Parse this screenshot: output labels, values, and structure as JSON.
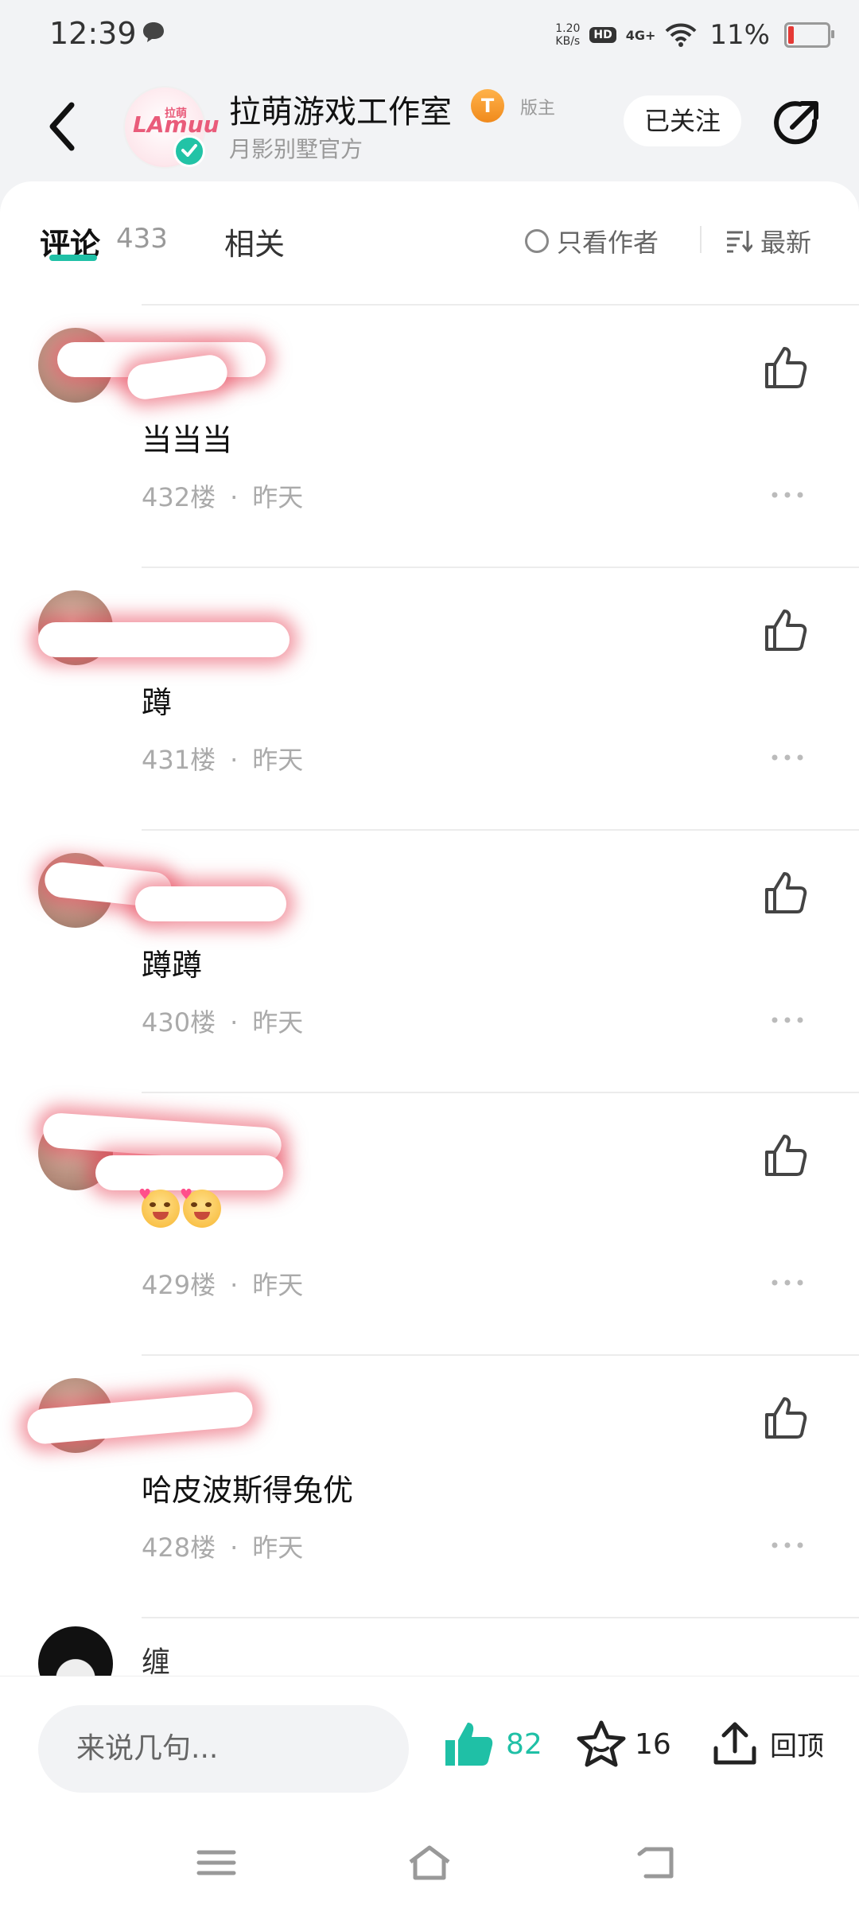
{
  "status": {
    "time": "12:39",
    "net_speed_top": "1.20",
    "net_speed_bottom": "KB/s",
    "hd": "HD",
    "signal": "4G+",
    "battery": "11%"
  },
  "header": {
    "title": "拉萌游戏工作室",
    "level_badge": "T",
    "role": "版主",
    "subtitle": "月影别墅官方",
    "follow_label": "已关注",
    "avatar_logo": "LAmuu",
    "avatar_logo_small": "拉萌"
  },
  "tabs": {
    "comment_label": "评论",
    "comment_count": "433",
    "related_label": "相关",
    "author_only": "只看作者",
    "sort": "最新"
  },
  "comments": [
    {
      "text": "当当当",
      "floor": "432楼",
      "time": "昨天"
    },
    {
      "text": "蹲",
      "floor": "431楼",
      "time": "昨天"
    },
    {
      "text": "蹲蹲",
      "floor": "430楼",
      "time": "昨天"
    },
    {
      "text": "",
      "floor": "429楼",
      "time": "昨天"
    },
    {
      "text": "哈皮波斯得兔优",
      "floor": "428楼",
      "time": "昨天"
    }
  ],
  "partial_comment": {
    "name": "缠"
  },
  "bottom_bar": {
    "input_placeholder": "来说几句...",
    "like_count": "82",
    "fav_count": "16",
    "top_label": "回顶"
  },
  "colors": {
    "accent": "#1fc0a6",
    "verify": "#22c3a6",
    "level": "#f08a1c"
  }
}
